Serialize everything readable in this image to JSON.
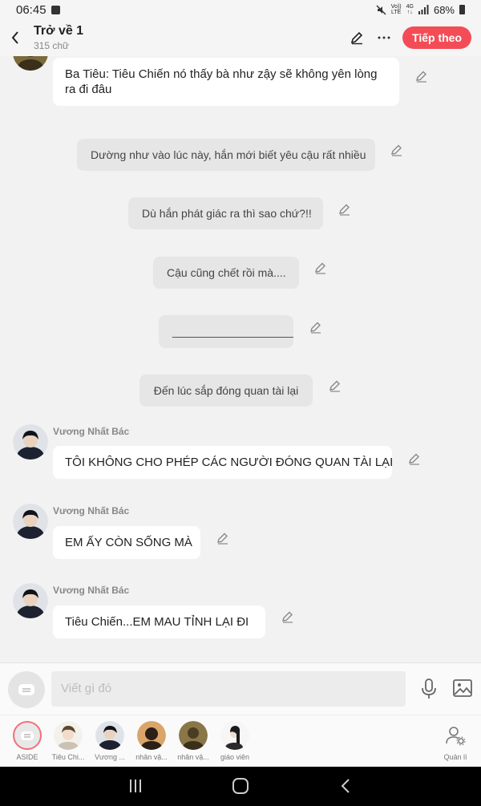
{
  "status": {
    "time": "06:45",
    "net_top": "Vo))",
    "net_bottom": "LTE",
    "lte_top": "4G",
    "lte_bottom": "↑↓",
    "battery": "68%"
  },
  "header": {
    "title": "Trở về 1",
    "subtitle": "315 chữ",
    "follow_label": "Tiếp theo"
  },
  "messages": [
    {
      "type": "character",
      "text": "Ba Tiêu: Tiêu Chiến nó thấy bà như zậy sẽ không yên lòng ra đi đâu"
    },
    {
      "type": "narration",
      "text": "Dường như vào lúc này, hắn mới biết yêu cậu rất nhiều"
    },
    {
      "type": "narration",
      "text": "Dù hắn phát giác ra thì sao chứ?!!"
    },
    {
      "type": "narration",
      "text": "Cậu cũng chết rồi mà...."
    },
    {
      "type": "narration",
      "text": "____________________"
    },
    {
      "type": "narration",
      "text": "Đến lúc sắp đóng quan tài lại"
    },
    {
      "type": "character",
      "speaker": "Vương Nhất Bác",
      "text": "TÔI KHÔNG CHO PHÉP CÁC NGƯỜI ĐÓNG QUAN TÀI LẠI"
    },
    {
      "type": "character",
      "speaker": "Vương Nhất Bác",
      "text": "EM ẤY CÒN SỐNG MÀ"
    },
    {
      "type": "character",
      "speaker": "Vương Nhất Bác",
      "text": "Tiêu Chiến...EM MAU TỈNH LẠI ĐI"
    }
  ],
  "composer": {
    "placeholder": "Viết gì đó"
  },
  "roster": {
    "characters": [
      {
        "label": "ASIDE"
      },
      {
        "label": "Tiêu Chi..."
      },
      {
        "label": "Vương ..."
      },
      {
        "label": "nhân vậ..."
      },
      {
        "label": "nhân vậ..."
      },
      {
        "label": "giáo viên"
      }
    ],
    "manage_label": "Quản lí"
  },
  "colors": {
    "accent": "#f44c56",
    "narration_bg": "#e6e6e6",
    "bubble_bg": "#ffffff",
    "background": "#f2f2f2"
  }
}
